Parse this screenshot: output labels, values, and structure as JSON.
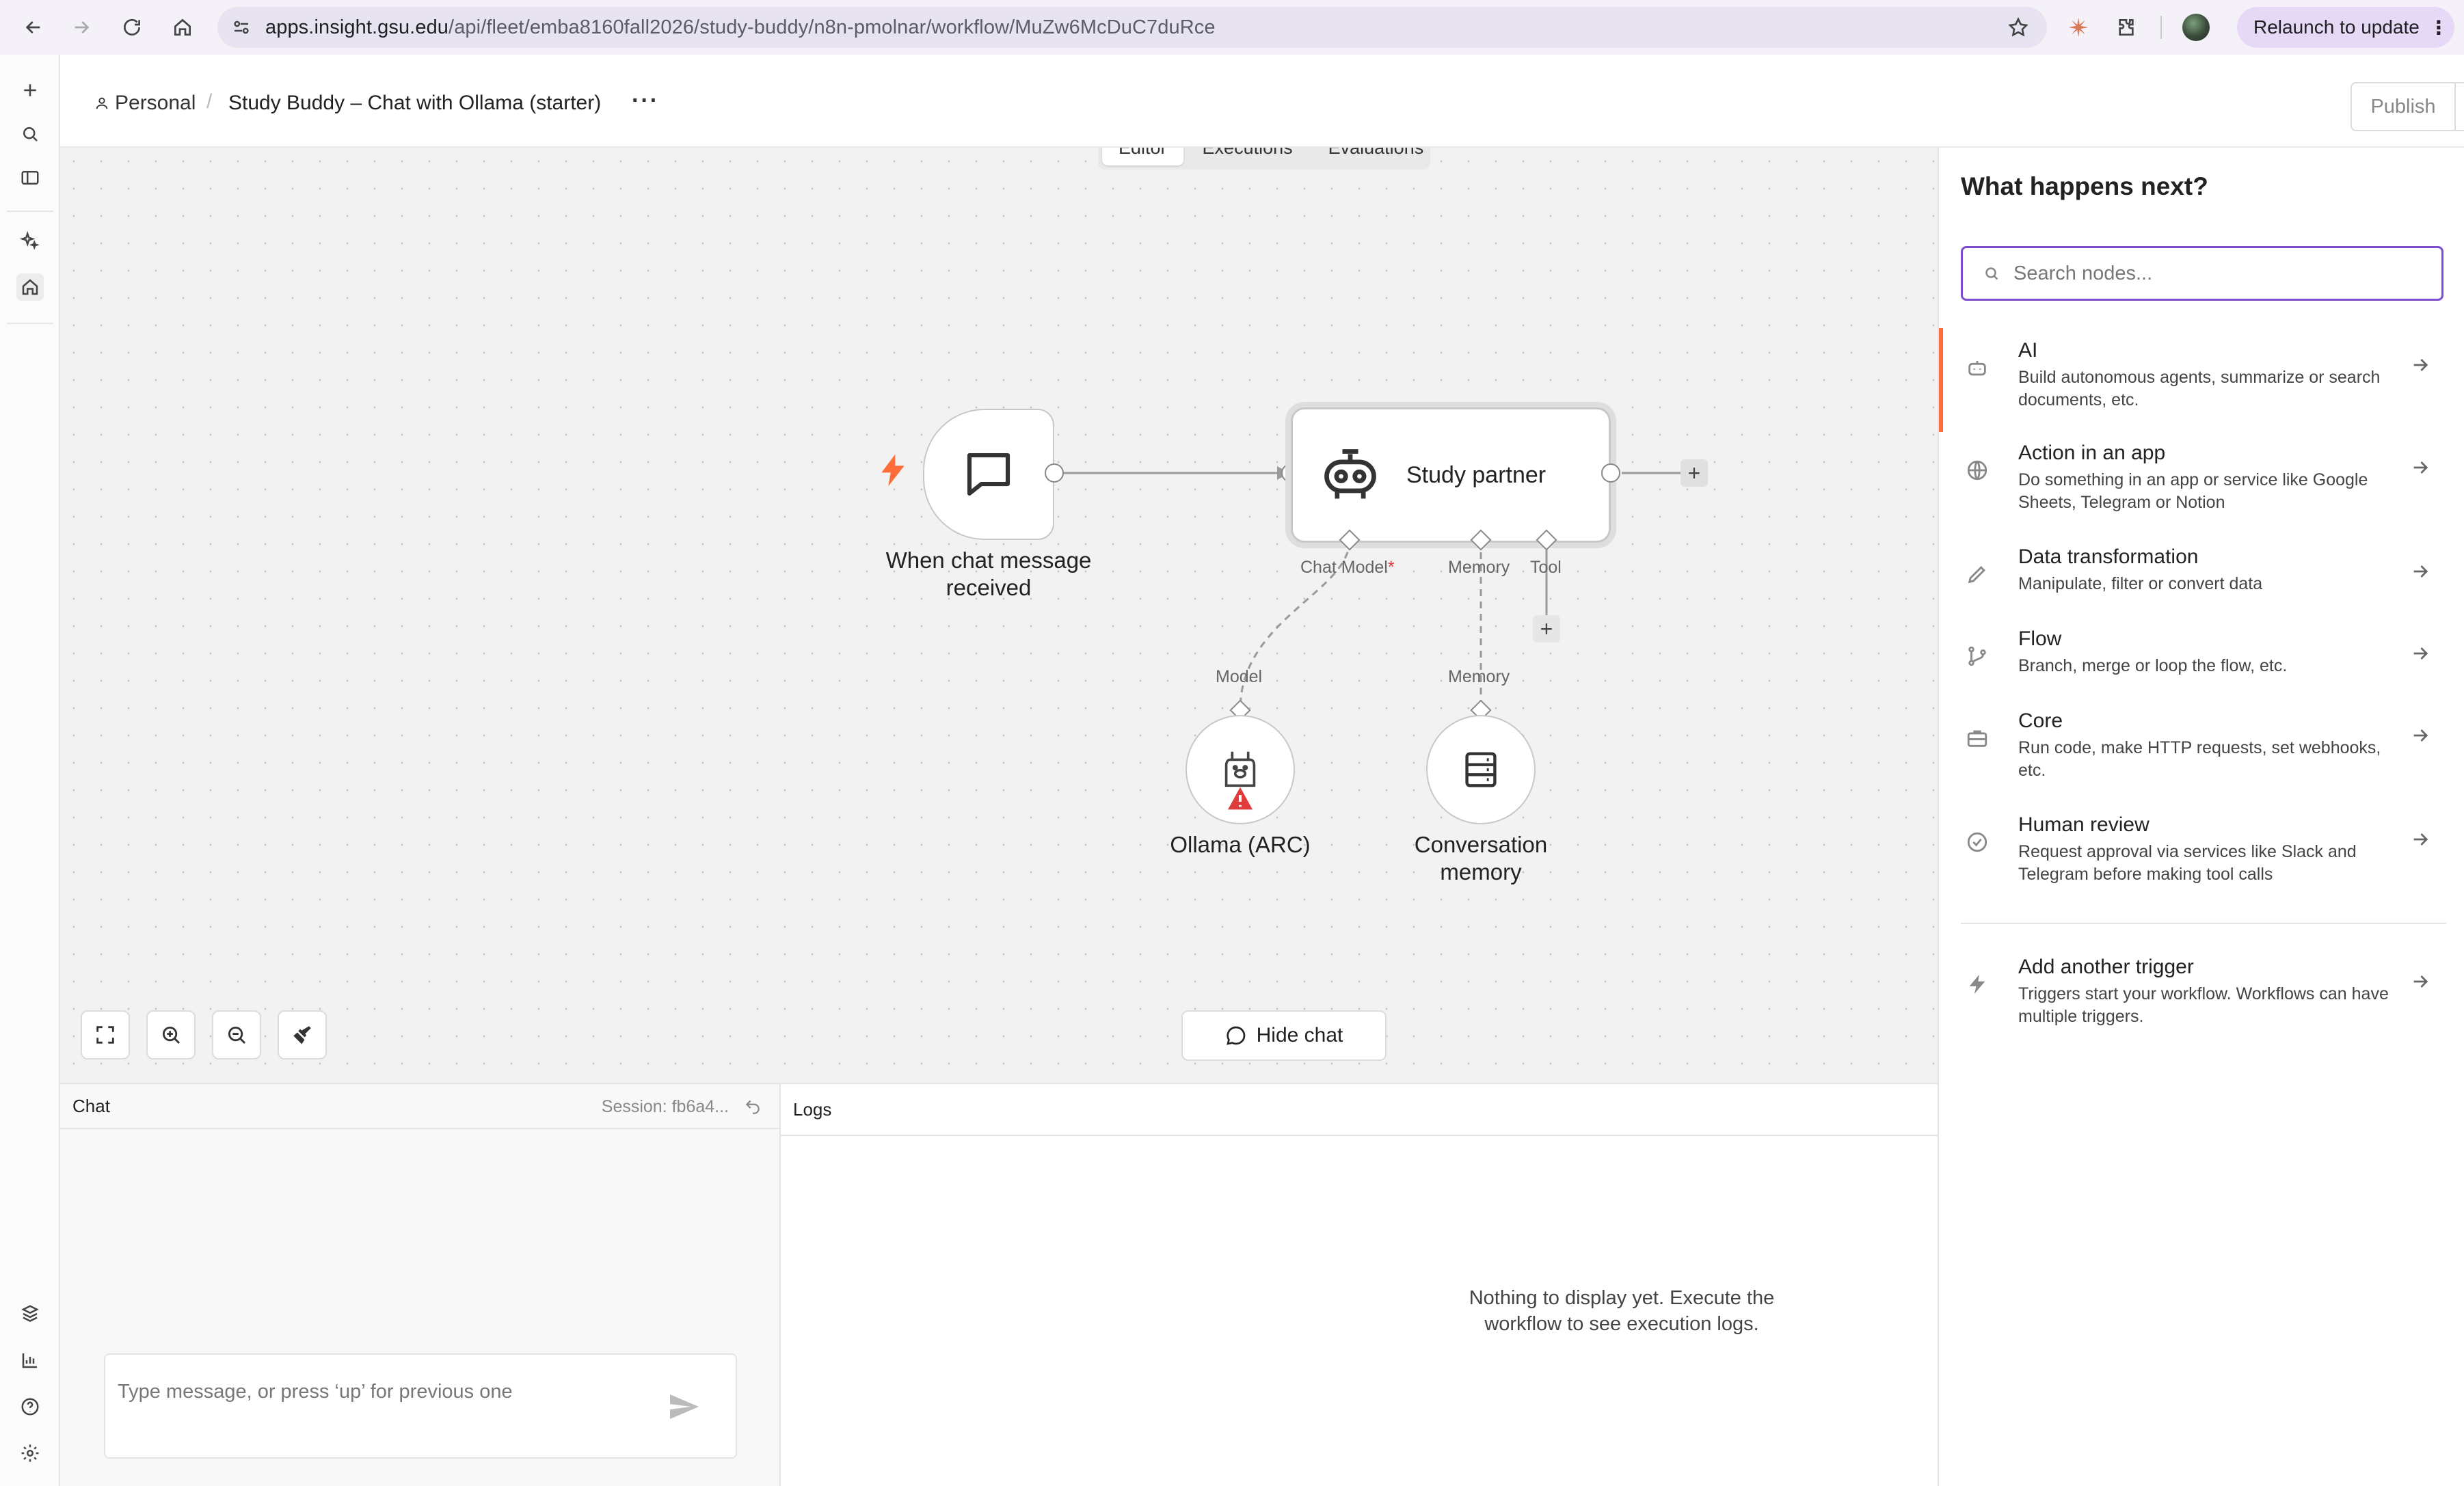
{
  "browser": {
    "url_host": "apps.insight.gsu.edu",
    "url_path": "/api/fleet/emba8160fall2026/study-buddy/n8n-pmolnar/workflow/MuZw6McDuC7duRce",
    "relaunch_label": "Relaunch to update"
  },
  "header": {
    "project": "Personal",
    "workflow_name": "Study Buddy – Chat with Ollama (starter)",
    "more": "···",
    "publish_label": "Publish"
  },
  "tabs": [
    "Editor",
    "Executions",
    "Evaluations"
  ],
  "nodes": {
    "trigger_label_line1": "When chat message",
    "trigger_label_line2": "received",
    "agent_title": "Study partner",
    "port_chat_model": "Chat Model",
    "port_required": "*",
    "port_memory": "Memory",
    "port_tool": "Tool",
    "model_input_label": "Model",
    "memory_input_label": "Memory",
    "ollama_label": "Ollama (ARC)",
    "memory_label_line1": "Conversation",
    "memory_label_line2": "memory"
  },
  "canvas": {
    "hide_chat_label": "Hide chat"
  },
  "chat": {
    "title": "Chat",
    "session": "Session: fb6a4...",
    "input_placeholder": "Type message, or press ‘up’ for previous one"
  },
  "logs": {
    "title": "Logs",
    "empty_line1": "Nothing to display yet. Execute the",
    "empty_line2": "workflow to see execution logs."
  },
  "right_panel": {
    "title": "What happens next?",
    "search_placeholder": "Search nodes...",
    "categories": [
      {
        "title": "AI",
        "desc": "Build autonomous agents, summarize or search documents, etc.",
        "icon": "robot-icon"
      },
      {
        "title": "Action in an app",
        "desc": "Do something in an app or service like Google Sheets, Telegram or Notion",
        "icon": "globe-icon"
      },
      {
        "title": "Data transformation",
        "desc": "Manipulate, filter or convert data",
        "icon": "pencil-icon"
      },
      {
        "title": "Flow",
        "desc": "Branch, merge or loop the flow, etc.",
        "icon": "branch-icon"
      },
      {
        "title": "Core",
        "desc": "Run code, make HTTP requests, set webhooks, etc.",
        "icon": "toolbox-icon"
      },
      {
        "title": "Human review",
        "desc": "Request approval via services like Slack and Telegram before making tool calls",
        "icon": "check-circle-icon"
      },
      {
        "title": "Add another trigger",
        "desc": "Triggers start your workflow. Workflows can have multiple triggers.",
        "icon": "bolt-icon"
      }
    ]
  },
  "colors": {
    "accent": "#ff6d3a",
    "search_border": "#7c4dce",
    "warning": "#e03c3c"
  }
}
